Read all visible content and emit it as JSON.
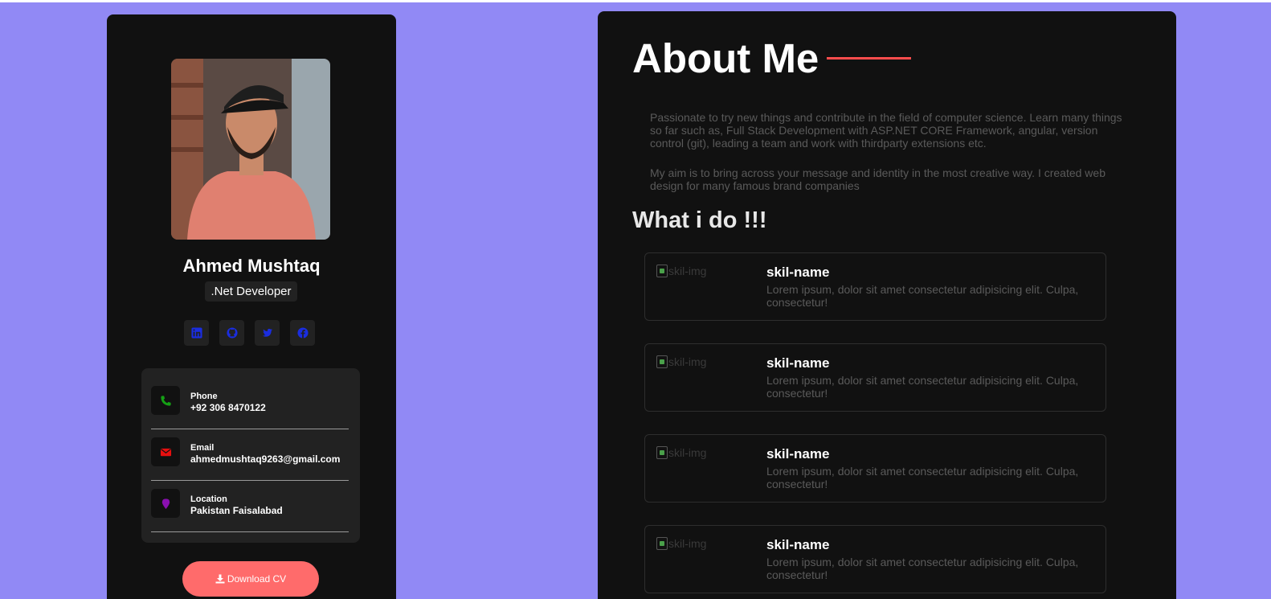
{
  "profile": {
    "name": "Ahmed Mushtaq",
    "role": ".Net Developer",
    "socials": [
      {
        "icon": "linkedin-icon",
        "color": "#1a2de0"
      },
      {
        "icon": "github-icon",
        "color": "#1a2de0"
      },
      {
        "icon": "twitter-icon",
        "color": "#1a2de0"
      },
      {
        "icon": "facebook-icon",
        "color": "#1a2de0"
      }
    ],
    "contacts": [
      {
        "label": "Phone",
        "value": "+92 306 8470122",
        "icon": "phone-icon",
        "color": "#15a015"
      },
      {
        "label": "Email",
        "value": "ahmedmushtaq9263@gmail.com",
        "icon": "envelope-icon",
        "color": "#e80f0f"
      },
      {
        "label": "Location",
        "value": "Pakistan Faisalabad",
        "icon": "map-pin-icon",
        "color": "#8a0fb0"
      }
    ],
    "download_label": "Download CV"
  },
  "about": {
    "title": "About Me",
    "paragraphs": [
      "Passionate to try new things and contribute in the field of computer science. Learn many things so far such as, Full Stack Development with ASP.NET CORE Framework, angular, version control (git), leading a team and work with thirdparty extensions etc.",
      "My aim is to bring across your message and identity in the most creative way. I created web design for many famous brand companies"
    ],
    "what_title": "What i do !!!",
    "skills": [
      {
        "img_alt": "skil-img",
        "name": "skil-name",
        "desc": "Lorem ipsum, dolor sit amet consectetur adipisicing elit. Culpa, consectetur!"
      },
      {
        "img_alt": "skil-img",
        "name": "skil-name",
        "desc": "Lorem ipsum, dolor sit amet consectetur adipisicing elit. Culpa, consectetur!"
      },
      {
        "img_alt": "skil-img",
        "name": "skil-name",
        "desc": "Lorem ipsum, dolor sit amet consectetur adipisicing elit. Culpa, consectetur!"
      },
      {
        "img_alt": "skil-img",
        "name": "skil-name",
        "desc": "Lorem ipsum, dolor sit amet consectetur adipisicing elit. Culpa, consectetur!"
      }
    ]
  },
  "colors": {
    "background": "#9189f5",
    "card": "#111111",
    "accent": "#ff6b6b",
    "title_line": "#ff4d4d"
  }
}
